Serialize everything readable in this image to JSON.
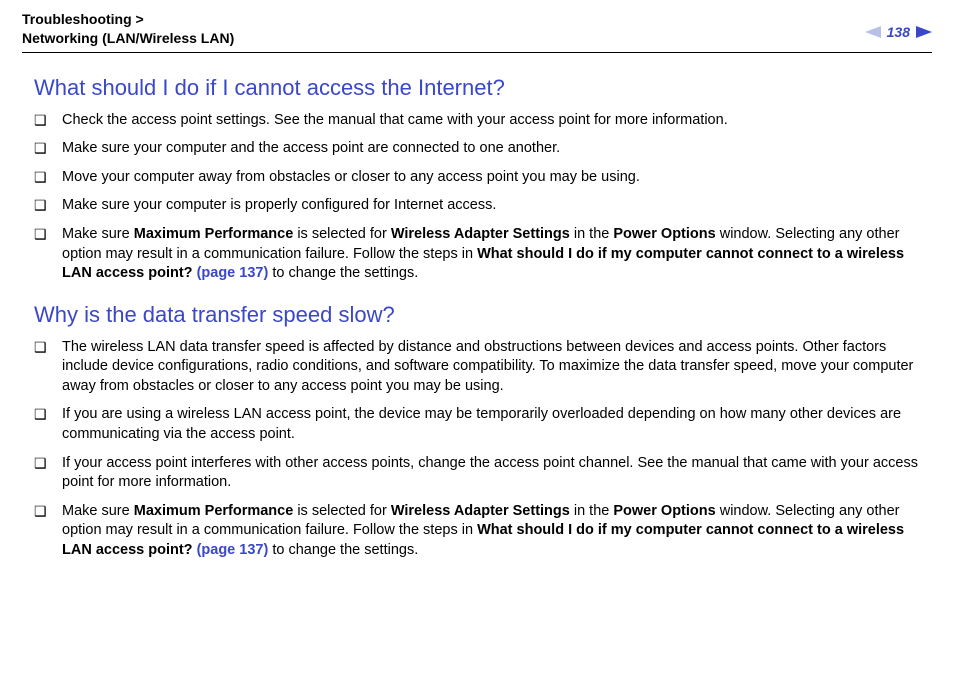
{
  "header": {
    "breadcrumb_line1": "Troubleshooting >",
    "breadcrumb_line2": "Networking (LAN/Wireless LAN)",
    "page_number": "138"
  },
  "sections": {
    "s1": {
      "title": "What should I do if I cannot access the Internet?",
      "i0": "Check the access point settings. See the manual that came with your access point for more information.",
      "i1": "Make sure your computer and the access point are connected to one another.",
      "i2": "Move your computer away from obstacles or closer to any access point you may be using.",
      "i3": "Make sure your computer is properly configured for Internet access.",
      "i4_a": "Make sure ",
      "i4_b": "Maximum Performance",
      "i4_c": " is selected for ",
      "i4_d": "Wireless Adapter Settings",
      "i4_e": " in the ",
      "i4_f": "Power Options",
      "i4_g": " window. Selecting any other option may result in a communication failure. Follow the steps in ",
      "i4_h": "What should I do if my computer cannot connect to a wireless LAN access point? ",
      "i4_i": "(page 137)",
      "i4_j": " to change the settings."
    },
    "s2": {
      "title": "Why is the data transfer speed slow?",
      "i0": "The wireless LAN data transfer speed is affected by distance and obstructions between devices and access points. Other factors include device configurations, radio conditions, and software compatibility. To maximize the data transfer speed, move your computer away from obstacles or closer to any access point you may be using.",
      "i1": "If you are using a wireless LAN access point, the device may be temporarily overloaded depending on how many other devices are communicating via the access point.",
      "i2": "If your access point interferes with other access points, change the access point channel. See the manual that came with your access point for more information.",
      "i3_a": "Make sure ",
      "i3_b": "Maximum Performance",
      "i3_c": " is selected for ",
      "i3_d": "Wireless Adapter Settings",
      "i3_e": " in the ",
      "i3_f": "Power Options",
      "i3_g": " window. Selecting any other option may result in a communication failure. Follow the steps in ",
      "i3_h": "What should I do if my computer cannot connect to a wireless LAN access point? ",
      "i3_i": "(page 137)",
      "i3_j": " to change the settings."
    }
  }
}
